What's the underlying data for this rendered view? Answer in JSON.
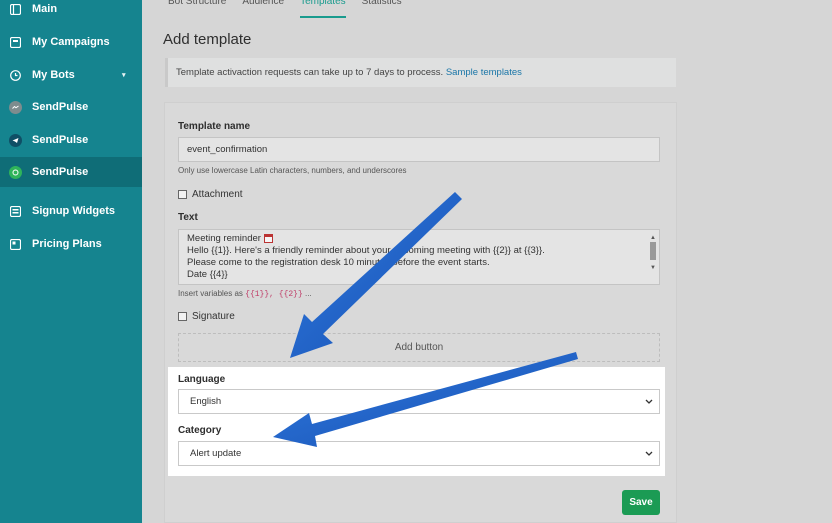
{
  "sidebar": {
    "items": [
      {
        "label": "Main",
        "icon": "grid-icon"
      },
      {
        "label": "My Campaigns",
        "icon": "mail-icon"
      },
      {
        "label": "My Bots",
        "icon": "clock-icon",
        "caret": "▾"
      },
      {
        "label": "SendPulse",
        "icon": "messenger-icon"
      },
      {
        "label": "SendPulse",
        "icon": "telegram-icon"
      },
      {
        "label": "SendPulse",
        "icon": "whatsapp-icon",
        "active": true
      },
      {
        "label": "Signup Widgets",
        "icon": "widget-icon"
      },
      {
        "label": "Pricing Plans",
        "icon": "pricing-icon"
      }
    ]
  },
  "tabs": [
    "Bot Structure",
    "Audience",
    "Templates",
    "Statistics"
  ],
  "page_title": "Add template",
  "notice": {
    "text": "Template activaction requests can take up to 7 days to process.",
    "link": "Sample templates"
  },
  "form": {
    "template_name_label": "Template name",
    "template_name_value": "event_confirmation",
    "template_name_hint": "Only use lowercase Latin characters, numbers, and underscores",
    "attachment_label": "Attachment",
    "text_label": "Text",
    "text_lines": [
      "Meeting reminder",
      "Hello {{1}}. Here's a friendly  reminder about your upcoming meeting with {{2}} at {{3}}.",
      "Please come to the registration desk 10 minutes before the event  starts.",
      "Date {{4}}"
    ],
    "variables_hint_prefix": "Insert variables as",
    "variables_hint_code": "{{1}}, {{2}}",
    "variables_hint_suffix": "...",
    "signature_label": "Signature",
    "add_button_label": "Add button",
    "language_label": "Language",
    "language_value": "English",
    "category_label": "Category",
    "category_value": "Alert update",
    "save_label": "Save"
  },
  "colors": {
    "sidebar": "#15848f",
    "accent": "#199b8e",
    "save": "#1b9b54",
    "arrow": "#1f5fc4"
  }
}
